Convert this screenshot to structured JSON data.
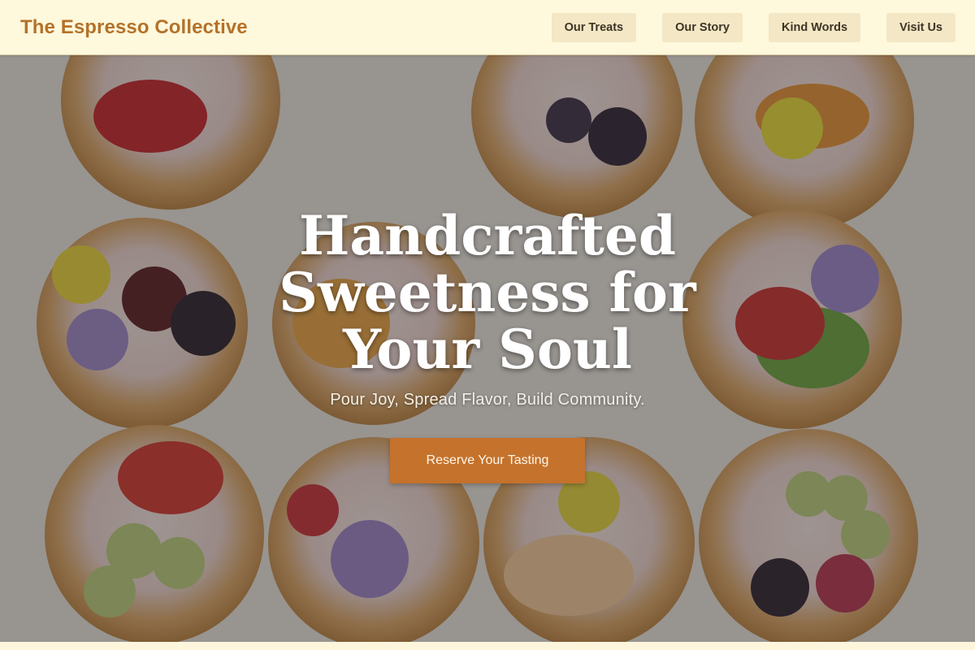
{
  "brand": {
    "name": "The Espresso Collective"
  },
  "nav": {
    "items": [
      {
        "label": "Our Treats"
      },
      {
        "label": "Our Story"
      },
      {
        "label": "Kind Words"
      },
      {
        "label": "Visit Us"
      }
    ]
  },
  "hero": {
    "title": "Handcrafted Sweetness for Your Soul",
    "tagline": "Pour Joy, Spread Flavor, Build Community.",
    "cta_label": "Reserve Your Tasting",
    "background": "photo of pastry tarts topped with cream, fruit and edible flowers"
  },
  "colors": {
    "header_bg": "#fef8dc",
    "brand_text": "#b4722a",
    "nav_button_bg": "#f3e7c5",
    "cta_bg": "#c4722c",
    "hero_text": "#ffffff"
  }
}
